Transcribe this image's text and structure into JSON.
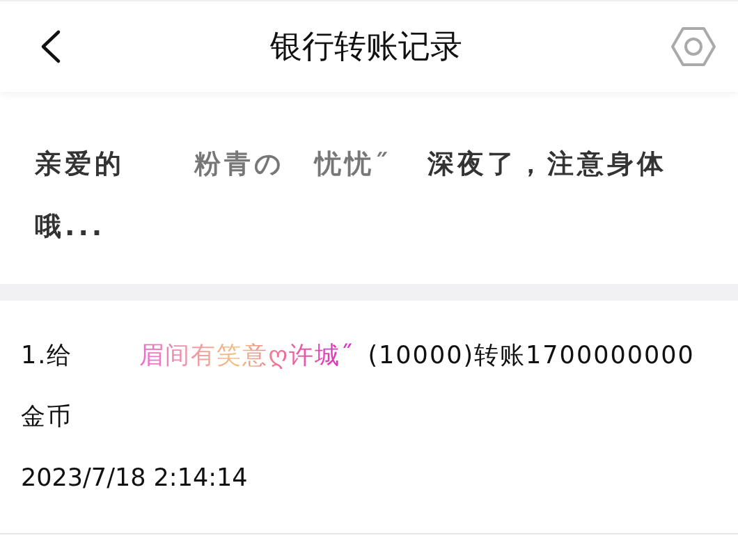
{
  "header": {
    "title": "银行转账记录"
  },
  "notice": {
    "prefix": "亲爱的",
    "name": "粉青の　忧忧˝",
    "suffix": "深夜了，注意身体哦..."
  },
  "records": [
    {
      "prefix": "1.给",
      "name": "眉间有笑意ღ许城˝",
      "suffix": "(10000)转账1700000000金币",
      "time": "2023/7/18 2:14:14"
    }
  ]
}
